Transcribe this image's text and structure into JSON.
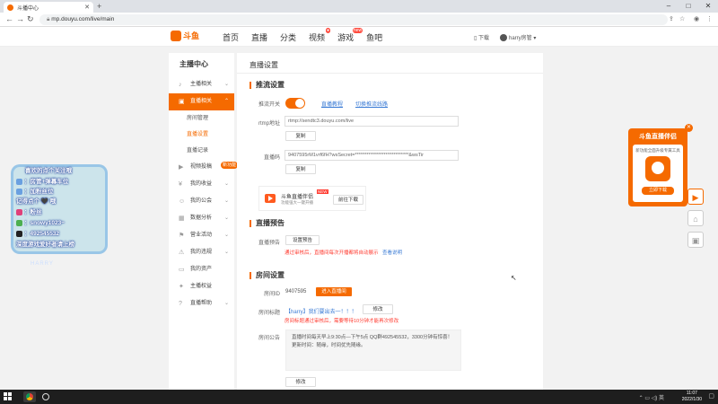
{
  "browser": {
    "tab_title": "斗播中心",
    "url": "mp.douyu.com/live/main",
    "user_label": "harry房管"
  },
  "site": {
    "logo_text": "斗鱼",
    "nav": [
      "首页",
      "直播",
      "分类",
      "视频",
      "游戏",
      "鱼吧"
    ],
    "hot_badge_index": 3,
    "download_label": "下载"
  },
  "sidebar": {
    "title": "主播中心",
    "items": [
      {
        "label": "主播相关",
        "icon": "mic-icon"
      },
      {
        "label": "直播相关",
        "icon": "tv-icon",
        "active": true
      },
      {
        "label": "房间管理",
        "sub": true
      },
      {
        "label": "直播设置",
        "sub": true,
        "current": true
      },
      {
        "label": "直播记录",
        "sub": true
      },
      {
        "label": "视频投稿",
        "icon": "video-icon",
        "badge": "新功能"
      },
      {
        "label": "我的收益",
        "icon": "coin-icon"
      },
      {
        "label": "我的公会",
        "icon": "group-icon"
      },
      {
        "label": "数据分析",
        "icon": "chart-icon"
      },
      {
        "label": "营业活动",
        "icon": "flag-icon"
      },
      {
        "label": "我的违规",
        "icon": "warning-icon"
      },
      {
        "label": "我的资产",
        "icon": "wallet-icon"
      },
      {
        "label": "主播权益",
        "icon": "gift-icon"
      },
      {
        "label": "直播帮助",
        "icon": "help-icon"
      }
    ]
  },
  "main": {
    "title": "直播设置",
    "push": {
      "section_title": "推流设置",
      "switch_label": "推流开关",
      "link1": "直播教程",
      "link2": "切换推流线路",
      "rtmp_label": "rtmp地址",
      "rtmp_value": "rtmp://sendtc3.douyu.com/live",
      "copy_label": "复制",
      "code_label": "直播码",
      "code_value": "9407595rM1vrf6fH?wsSecret=****************************&wsTir",
      "copy_label2": "复制"
    },
    "promo": {
      "title": "斗鱼直播伴侣",
      "tag": "NEW",
      "subtitle": "功能强大一键开播",
      "button": "前往下载"
    },
    "preview": {
      "section_title": "直播预告",
      "label": "直播预告",
      "button": "设置预告",
      "note_red": "通过审核后，直播间每次开播都将自动展示",
      "note_link": "查看说明"
    },
    "room": {
      "section_title": "房间设置",
      "id_label": "房间ID",
      "id_value": "9407595",
      "enter_button": "进入直播间",
      "title_label": "房间标题",
      "title_value": "【harry】我们要出去一！！！",
      "edit_button": "修改",
      "title_note": "房间标题通过审核后，需要等待10分钟才能再次修改",
      "notice_label": "房间公告",
      "notice_text": "直播时间每天早上9:30点—下午5点 QQ群492545532，3300分钟有惊喜！更新时间：随缘，时间优先随缘。",
      "edit_button2": "修改"
    }
  },
  "widget": {
    "title": "斗鱼直播伴侣",
    "desc": "新功能全面升级专属工具",
    "button": "立即下载"
  },
  "overlay": {
    "lines": [
      "喜欢的点个关注哦",
      "：房管+弹幕车位",
      "：加粉丝位",
      "记得点个 🖤 哦",
      "：粉丝",
      "：snowy1023~",
      "：492545532",
      "深度游戏爱好者请上榜"
    ],
    "footer": "HARRY"
  },
  "taskbar": {
    "time": "11:07",
    "date": "2022/1/30",
    "ime": "英"
  }
}
